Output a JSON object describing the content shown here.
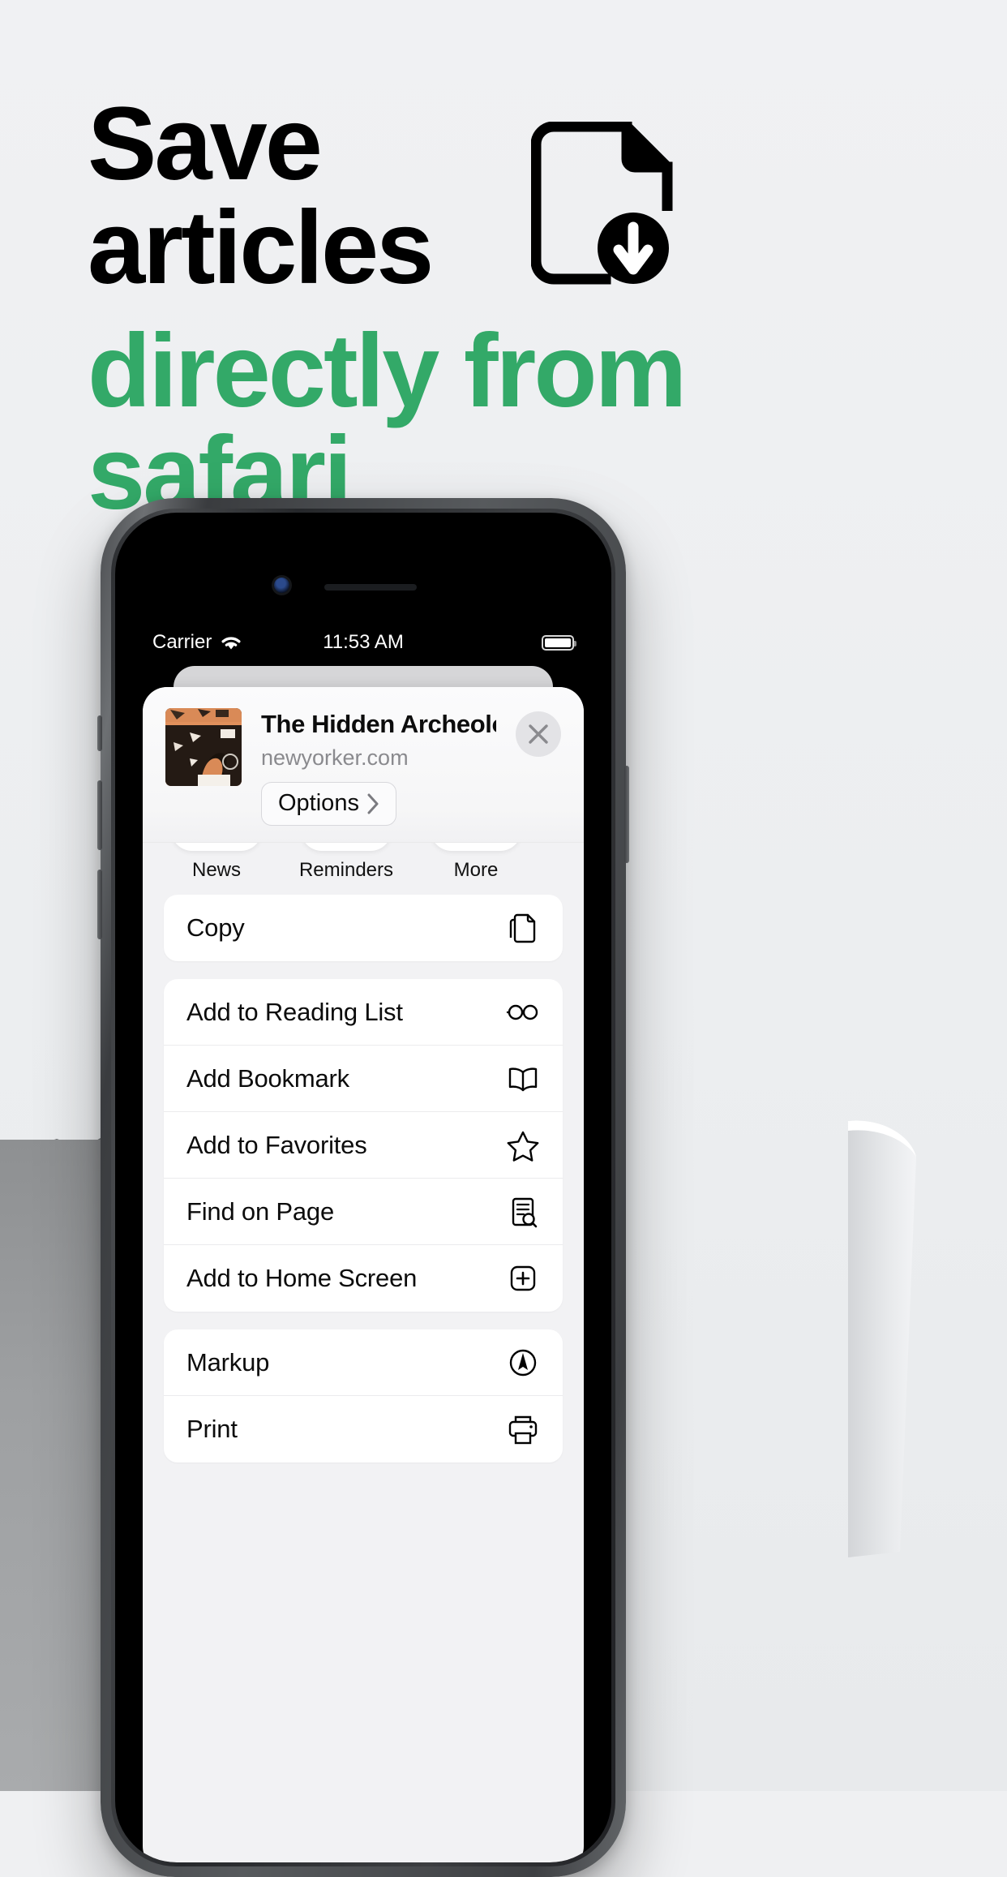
{
  "headline": {
    "line1": "Save",
    "line2": "articles",
    "line3": "directly from",
    "line4": "safari",
    "accent_color": "#33a968",
    "text_color": "#000000",
    "icon": "document-download-icon"
  },
  "background": {
    "color": "#eff0f2"
  },
  "phone": {
    "status_bar": {
      "carrier": "Carrier",
      "wifi_icon": "wifi-icon",
      "time": "11:53 AM",
      "battery_icon": "battery-full-icon"
    },
    "share_sheet": {
      "header": {
        "thumbnail": "article-thumbnail",
        "title": "The Hidden Archeologists of At...",
        "subtitle": "newyorker.com",
        "options_label": "Options",
        "options_chevron": "chevron-right-icon",
        "close_icon": "close-icon"
      },
      "app_row": [
        {
          "label": "News",
          "icon": "news-app-icon"
        },
        {
          "label": "Reminders",
          "icon": "reminders-app-icon"
        },
        {
          "label": "More",
          "icon": "more-app-icon"
        }
      ],
      "groups": [
        {
          "rows": [
            {
              "label": "Copy",
              "icon": "copy-icon"
            }
          ]
        },
        {
          "rows": [
            {
              "label": "Add to Reading List",
              "icon": "glasses-icon"
            },
            {
              "label": "Add Bookmark",
              "icon": "book-icon"
            },
            {
              "label": "Add to Favorites",
              "icon": "star-icon"
            },
            {
              "label": "Find on Page",
              "icon": "find-page-icon"
            },
            {
              "label": "Add to Home Screen",
              "icon": "plus-square-icon"
            }
          ]
        },
        {
          "rows": [
            {
              "label": "Markup",
              "icon": "markup-icon"
            },
            {
              "label": "Print",
              "icon": "printer-icon"
            }
          ]
        }
      ]
    }
  }
}
